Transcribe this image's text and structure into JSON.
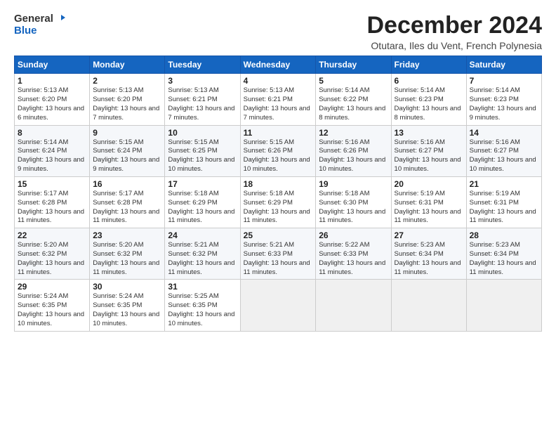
{
  "logo": {
    "general": "General",
    "blue": "Blue"
  },
  "header": {
    "title": "December 2024",
    "subtitle": "Otutara, Iles du Vent, French Polynesia"
  },
  "weekdays": [
    "Sunday",
    "Monday",
    "Tuesday",
    "Wednesday",
    "Thursday",
    "Friday",
    "Saturday"
  ],
  "weeks": [
    [
      {
        "day": "1",
        "sunrise": "5:13 AM",
        "sunset": "6:20 PM",
        "daylight": "13 hours and 6 minutes."
      },
      {
        "day": "2",
        "sunrise": "5:13 AM",
        "sunset": "6:20 PM",
        "daylight": "13 hours and 7 minutes."
      },
      {
        "day": "3",
        "sunrise": "5:13 AM",
        "sunset": "6:21 PM",
        "daylight": "13 hours and 7 minutes."
      },
      {
        "day": "4",
        "sunrise": "5:13 AM",
        "sunset": "6:21 PM",
        "daylight": "13 hours and 7 minutes."
      },
      {
        "day": "5",
        "sunrise": "5:14 AM",
        "sunset": "6:22 PM",
        "daylight": "13 hours and 8 minutes."
      },
      {
        "day": "6",
        "sunrise": "5:14 AM",
        "sunset": "6:23 PM",
        "daylight": "13 hours and 8 minutes."
      },
      {
        "day": "7",
        "sunrise": "5:14 AM",
        "sunset": "6:23 PM",
        "daylight": "13 hours and 9 minutes."
      }
    ],
    [
      {
        "day": "8",
        "sunrise": "5:14 AM",
        "sunset": "6:24 PM",
        "daylight": "13 hours and 9 minutes."
      },
      {
        "day": "9",
        "sunrise": "5:15 AM",
        "sunset": "6:24 PM",
        "daylight": "13 hours and 9 minutes."
      },
      {
        "day": "10",
        "sunrise": "5:15 AM",
        "sunset": "6:25 PM",
        "daylight": "13 hours and 10 minutes."
      },
      {
        "day": "11",
        "sunrise": "5:15 AM",
        "sunset": "6:26 PM",
        "daylight": "13 hours and 10 minutes."
      },
      {
        "day": "12",
        "sunrise": "5:16 AM",
        "sunset": "6:26 PM",
        "daylight": "13 hours and 10 minutes."
      },
      {
        "day": "13",
        "sunrise": "5:16 AM",
        "sunset": "6:27 PM",
        "daylight": "13 hours and 10 minutes."
      },
      {
        "day": "14",
        "sunrise": "5:16 AM",
        "sunset": "6:27 PM",
        "daylight": "13 hours and 10 minutes."
      }
    ],
    [
      {
        "day": "15",
        "sunrise": "5:17 AM",
        "sunset": "6:28 PM",
        "daylight": "13 hours and 11 minutes."
      },
      {
        "day": "16",
        "sunrise": "5:17 AM",
        "sunset": "6:28 PM",
        "daylight": "13 hours and 11 minutes."
      },
      {
        "day": "17",
        "sunrise": "5:18 AM",
        "sunset": "6:29 PM",
        "daylight": "13 hours and 11 minutes."
      },
      {
        "day": "18",
        "sunrise": "5:18 AM",
        "sunset": "6:29 PM",
        "daylight": "13 hours and 11 minutes."
      },
      {
        "day": "19",
        "sunrise": "5:18 AM",
        "sunset": "6:30 PM",
        "daylight": "13 hours and 11 minutes."
      },
      {
        "day": "20",
        "sunrise": "5:19 AM",
        "sunset": "6:31 PM",
        "daylight": "13 hours and 11 minutes."
      },
      {
        "day": "21",
        "sunrise": "5:19 AM",
        "sunset": "6:31 PM",
        "daylight": "13 hours and 11 minutes."
      }
    ],
    [
      {
        "day": "22",
        "sunrise": "5:20 AM",
        "sunset": "6:32 PM",
        "daylight": "13 hours and 11 minutes."
      },
      {
        "day": "23",
        "sunrise": "5:20 AM",
        "sunset": "6:32 PM",
        "daylight": "13 hours and 11 minutes."
      },
      {
        "day": "24",
        "sunrise": "5:21 AM",
        "sunset": "6:32 PM",
        "daylight": "13 hours and 11 minutes."
      },
      {
        "day": "25",
        "sunrise": "5:21 AM",
        "sunset": "6:33 PM",
        "daylight": "13 hours and 11 minutes."
      },
      {
        "day": "26",
        "sunrise": "5:22 AM",
        "sunset": "6:33 PM",
        "daylight": "13 hours and 11 minutes."
      },
      {
        "day": "27",
        "sunrise": "5:23 AM",
        "sunset": "6:34 PM",
        "daylight": "13 hours and 11 minutes."
      },
      {
        "day": "28",
        "sunrise": "5:23 AM",
        "sunset": "6:34 PM",
        "daylight": "13 hours and 11 minutes."
      }
    ],
    [
      {
        "day": "29",
        "sunrise": "5:24 AM",
        "sunset": "6:35 PM",
        "daylight": "13 hours and 10 minutes."
      },
      {
        "day": "30",
        "sunrise": "5:24 AM",
        "sunset": "6:35 PM",
        "daylight": "13 hours and 10 minutes."
      },
      {
        "day": "31",
        "sunrise": "5:25 AM",
        "sunset": "6:35 PM",
        "daylight": "13 hours and 10 minutes."
      },
      null,
      null,
      null,
      null
    ]
  ],
  "labels": {
    "sunrise": "Sunrise: ",
    "sunset": "Sunset: ",
    "daylight": "Daylight: "
  }
}
